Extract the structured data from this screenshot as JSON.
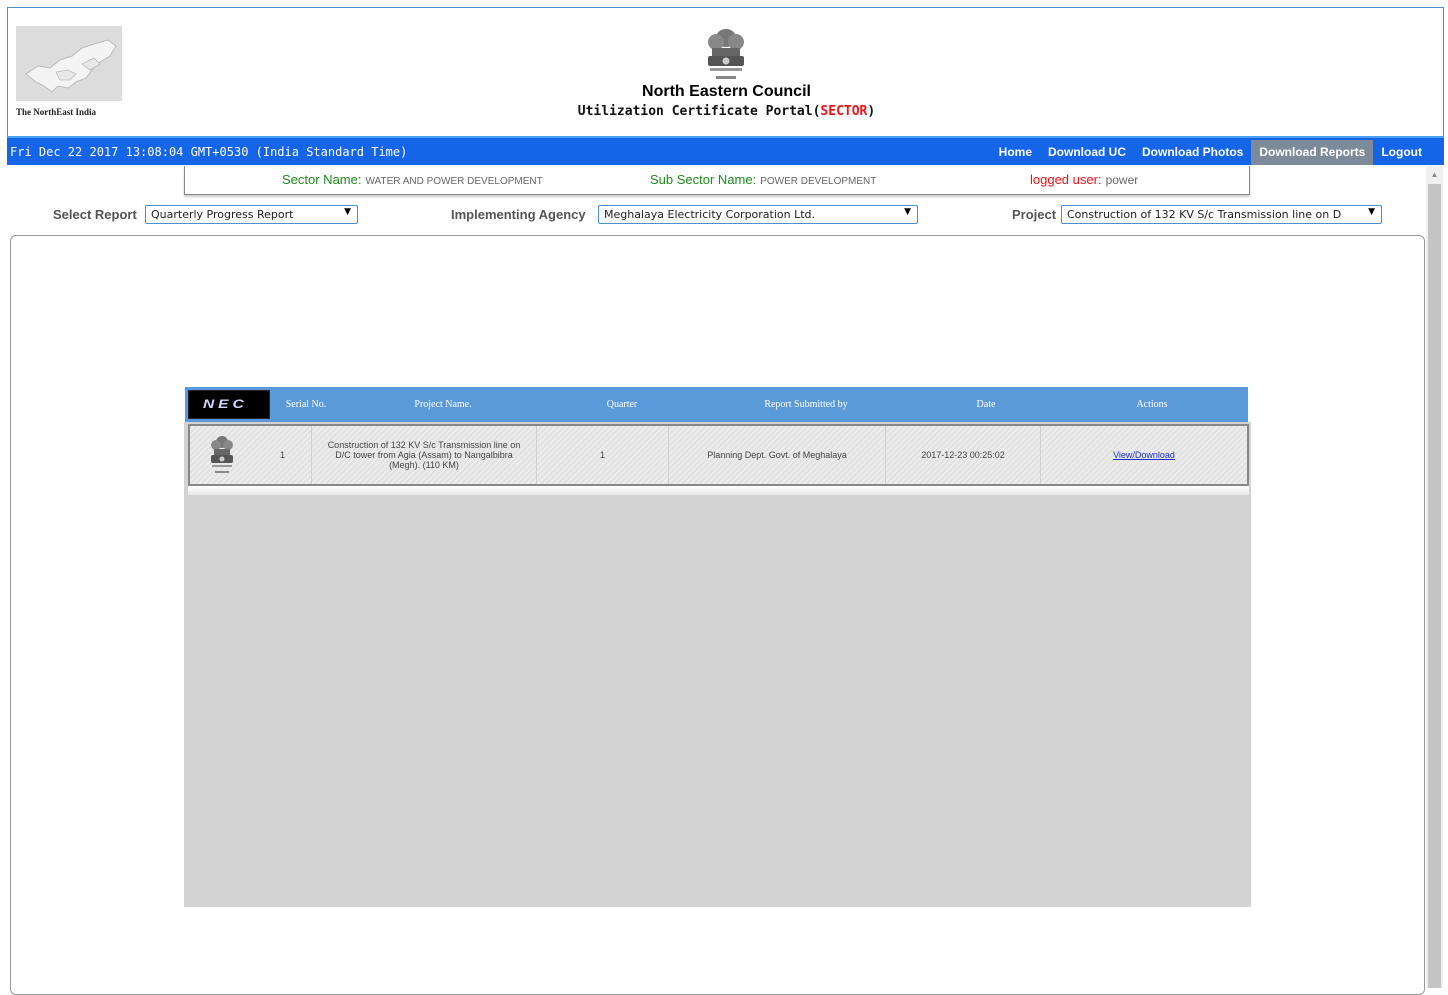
{
  "header": {
    "map_caption": "The NorthEast India",
    "council_title": "North Eastern Council",
    "portal_title_prefix": "Utilization Certificate Portal(",
    "portal_title_highlight": "SECTOR",
    "portal_title_suffix": ")"
  },
  "navbar": {
    "datetime": "Fri Dec 22 2017 13:08:04 GMT+0530 (India Standard Time)",
    "items": [
      "Home",
      "Download UC",
      "Download Photos",
      "Download Reports",
      "Logout"
    ],
    "active_item": "Download Reports"
  },
  "info": {
    "sector_label": "Sector Name:",
    "sector_value": "WATER AND POWER DEVELOPMENT",
    "subsector_label": "Sub Sector Name:",
    "subsector_value": "POWER DEVELOPMENT",
    "user_label": "logged user:",
    "user_value": "power"
  },
  "filters": {
    "report_label": "Select Report",
    "report_value": "Quarterly Progress Report",
    "agency_label": "Implementing Agency",
    "agency_value": "Meghalaya Electricity Corporation Ltd.",
    "project_label": "Project",
    "project_value": "Construction of 132 KV S/c Transmission line on D"
  },
  "table": {
    "logo_text": "NEC",
    "columns": [
      "Serial No.",
      "Project Name.",
      "Quarter",
      "Report Submitted by",
      "Date",
      "Actions"
    ],
    "rows": [
      {
        "serial": "1",
        "project_name": "Construction of 132 KV S/c Transmission line on D/C tower from Agia (Assam) to Nangalbibra (Megh). (110 KM)",
        "quarter": "1",
        "submitted_by": "Planning Dept. Govt. of Meghalaya",
        "date": "2017-12-23 00:25:02",
        "action": "View/Download"
      }
    ]
  },
  "colors": {
    "navbar": "#1565e8",
    "table_header": "#5b9ad9",
    "accent_red": "#e8141a",
    "label_green": "#1e8b1e"
  }
}
